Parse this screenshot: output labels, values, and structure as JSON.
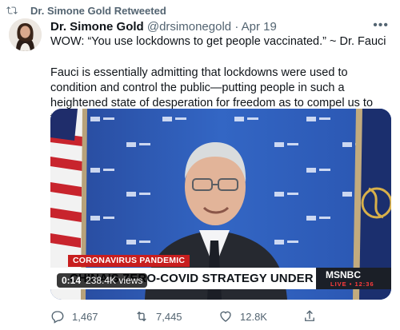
{
  "retweet": {
    "label": "Dr. Simone Gold Retweeted"
  },
  "tweet": {
    "author_name": "Dr. Simone Gold",
    "handle": "@drsimonegold",
    "separator": "·",
    "date": "Apr 19",
    "text_line1": "WOW: “You use lockdowns to get people vaccinated.” ~ Dr. Fauci",
    "text_body": "Fauci is essentially admitting that lockdowns were used to condition and control the public—putting people in such a heightened state of desperation for freedom as to compel us to take the vaccine.",
    "more_icon": "•••"
  },
  "video": {
    "tag": "CORONAVIRUS PANDEMIC",
    "headline": "CHINA'S ZERO-COVID STRATEGY UNDER SCRUTINY",
    "network": "MSNBC",
    "live_label": "LIVE • 12:36",
    "duration": "0:14",
    "views": "238.4K views"
  },
  "actions": {
    "replies": "1,467",
    "retweets": "7,445",
    "likes": "12.8K",
    "share": ""
  },
  "colors": {
    "text": "#0f1419",
    "muted": "#536471",
    "tag_red": "#c81e1e",
    "backdrop_blue": "#2e5cb3"
  }
}
